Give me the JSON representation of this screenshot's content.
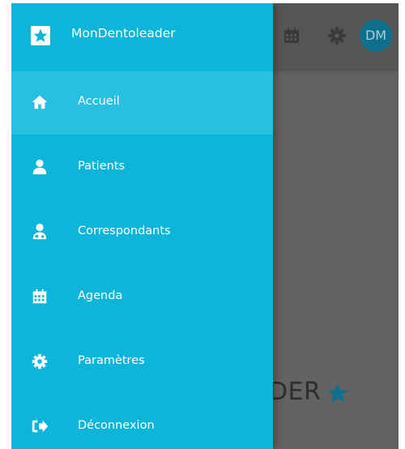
{
  "app": {
    "name": "MonDentoleader"
  },
  "header": {
    "avatar_initials": "DM"
  },
  "background": {
    "brand_fragment": "DER"
  },
  "nav": {
    "items": [
      {
        "label": "Accueil",
        "icon": "home-icon",
        "active": true
      },
      {
        "label": "Patients",
        "icon": "user-icon",
        "active": false
      },
      {
        "label": "Correspondants",
        "icon": "user-md-icon",
        "active": false
      },
      {
        "label": "Agenda",
        "icon": "calendar-icon",
        "active": false
      },
      {
        "label": "Paramètres",
        "icon": "gear-icon",
        "active": false
      },
      {
        "label": "Déconnexion",
        "icon": "sign-out-icon",
        "active": false
      }
    ]
  },
  "colors": {
    "drawer": "#0cb5d9",
    "active_item": "#27c0e1",
    "overlay": "#626262",
    "avatar": "#0f6f8c",
    "brand_star": "#0f6f8c"
  }
}
